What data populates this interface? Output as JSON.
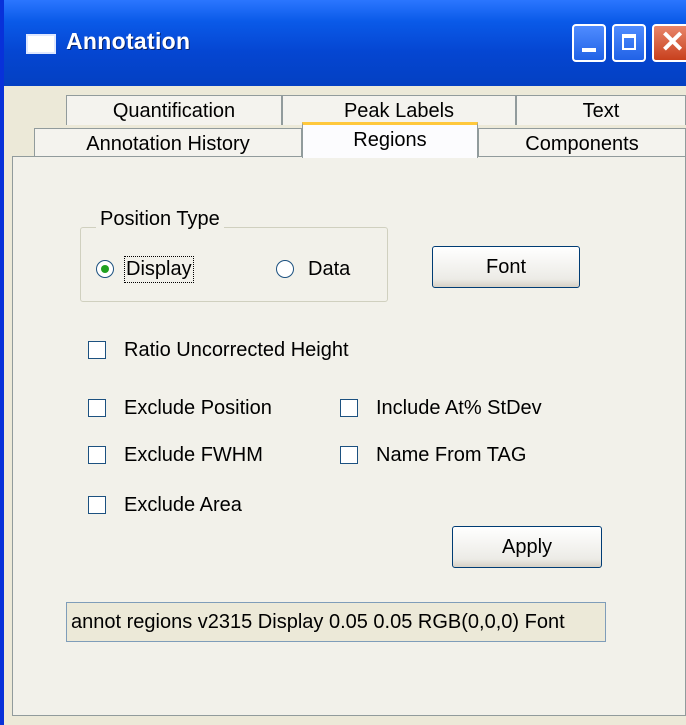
{
  "window": {
    "title": "Annotation",
    "controls": [
      "minimize",
      "maximize",
      "close"
    ]
  },
  "tabs": {
    "row1": [
      {
        "label": "Quantification"
      },
      {
        "label": "Peak Labels"
      },
      {
        "label": "Text"
      }
    ],
    "row2": [
      {
        "label": "Annotation History"
      },
      {
        "label": "Regions",
        "selected": true
      },
      {
        "label": "Components"
      }
    ]
  },
  "position_type": {
    "group_label": "Position Type",
    "options": [
      {
        "label": "Display",
        "checked": true
      },
      {
        "label": "Data",
        "checked": false
      }
    ]
  },
  "buttons": {
    "font": "Font",
    "apply": "Apply"
  },
  "checkboxes": [
    {
      "label": "Ratio Uncorrected Height",
      "checked": false
    },
    {
      "label": "Exclude Position",
      "checked": false
    },
    {
      "label": "Include At% StDev",
      "checked": false
    },
    {
      "label": "Exclude FWHM",
      "checked": false
    },
    {
      "label": "Name From TAG",
      "checked": false
    },
    {
      "label": "Exclude Area",
      "checked": false
    }
  ],
  "command_text": "annot regions v2315 Display 0.05 0.05 RGB(0,0,0) Font",
  "colors": {
    "titlebar": "#0a5ae8",
    "dialog_bg": "#ece9d8",
    "selected_tab_highlight": "#ffc83c",
    "radio_dot": "#21a121"
  }
}
